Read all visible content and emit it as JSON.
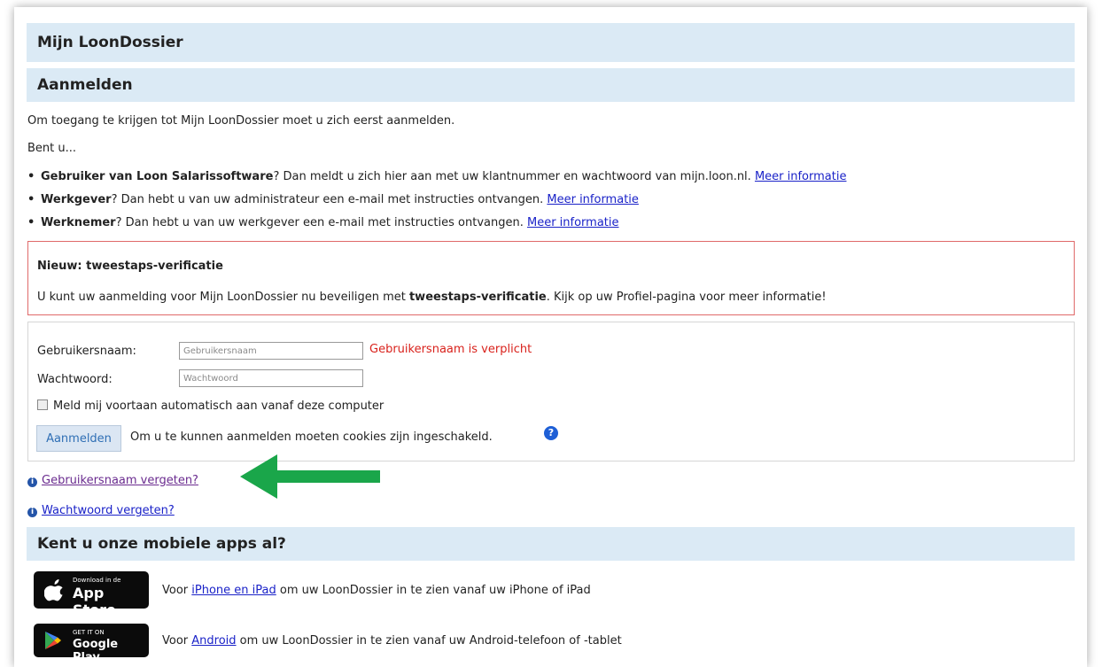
{
  "headings": {
    "title": "Mijn LoonDossier",
    "login": "Aanmelden",
    "apps": "Kent u onze mobiele apps al?"
  },
  "intro": {
    "line1": "Om toegang te krijgen tot Mijn LoonDossier moet u zich eerst aanmelden.",
    "line2": "Bent u..."
  },
  "options": [
    {
      "bold": "Gebruiker van Loon Salarissoftware",
      "text": "? Dan meldt u zich hier aan met uw klantnummer en wachtwoord van mijn.loon.nl. ",
      "link": "Meer informatie"
    },
    {
      "bold": "Werkgever",
      "text": "? Dan hebt u van uw administrateur een e-mail met instructies ontvangen. ",
      "link": "Meer informatie"
    },
    {
      "bold": "Werknemer",
      "text": "? Dan hebt u van uw werkgever een e-mail met instructies ontvangen. ",
      "link": "Meer informatie"
    }
  ],
  "notice": {
    "title": "Nieuw: tweestaps-verificatie",
    "before": "U kunt uw aanmelding voor Mijn LoonDossier nu beveiligen met ",
    "bold": "tweestaps-verificatie",
    "after": ". Kijk op uw Profiel-pagina voor meer informatie!"
  },
  "form": {
    "username_label": "Gebruikersnaam:",
    "username_placeholder": "Gebruikersnaam",
    "username_error": "Gebruikersnaam is verplicht",
    "password_label": "Wachtwoord:",
    "password_placeholder": "Wachtwoord",
    "remember_label": "Meld mij voortaan automatisch aan vanaf deze computer",
    "submit_label": "Aanmelden",
    "cookie_note": "Om u te kunnen aanmelden moeten cookies zijn ingeschakeld.",
    "help_icon": "?"
  },
  "recovery": {
    "forgot_username": "Gebruikersnaam vergeten?",
    "forgot_password": "Wachtwoord vergeten?",
    "info_icon": "i"
  },
  "annotation": {
    "arrow_color": "#1aa64a"
  },
  "apps": {
    "apple": {
      "badge_small": "Download in de",
      "badge_big": "App Store",
      "prefix": "Voor ",
      "link": "iPhone en iPad",
      "suffix": " om uw LoonDossier in te zien vanaf uw iPhone of iPad"
    },
    "google": {
      "badge_small": "GET IT ON",
      "badge_big": "Google Play",
      "prefix": "Voor ",
      "link": "Android",
      "suffix": " om uw LoonDossier in te zien vanaf uw Android-telefoon of -tablet"
    }
  },
  "colors": {
    "band": "#dbeaf5",
    "error": "#d9221c",
    "notice_border": "#e06a6a",
    "link": "#1a22c8"
  }
}
